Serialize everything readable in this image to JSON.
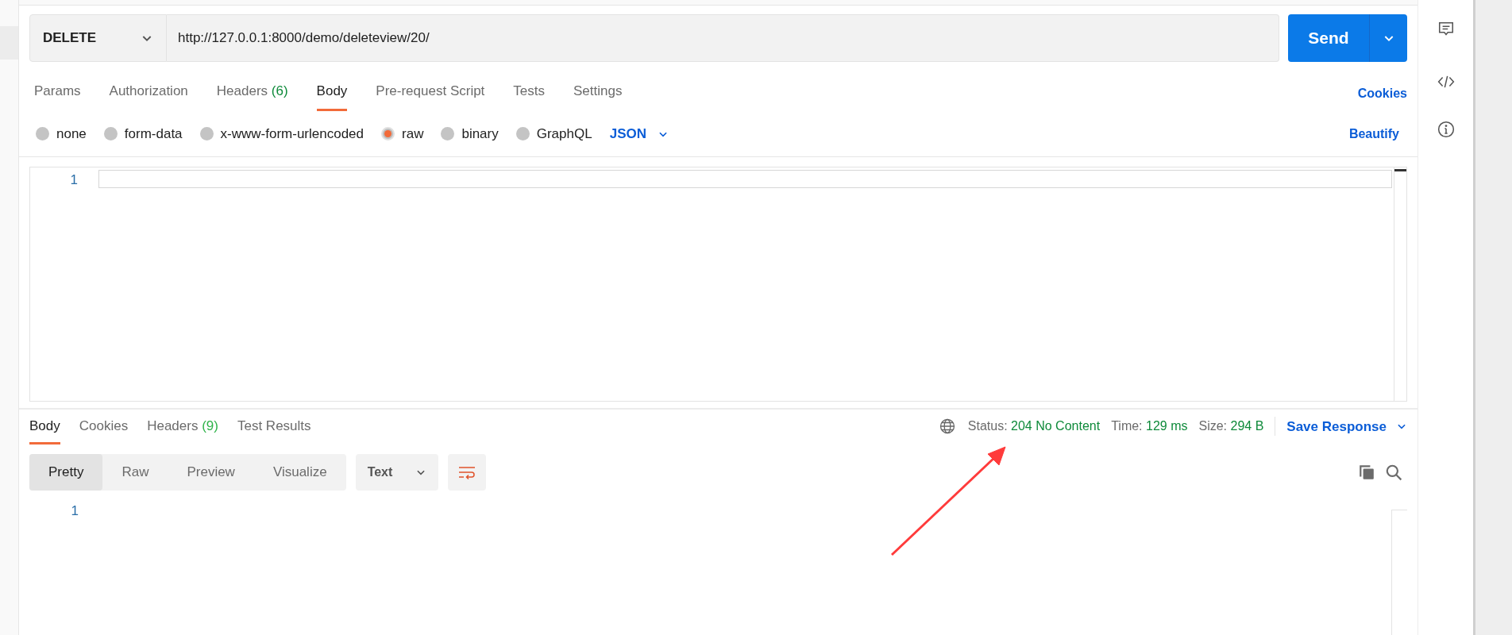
{
  "request": {
    "method": "DELETE",
    "url": "http://127.0.0.1:8000/demo/deleteview/20/",
    "send": "Send"
  },
  "request_tabs": [
    {
      "label": "Params",
      "selected": false
    },
    {
      "label": "Authorization",
      "selected": false
    },
    {
      "label": "Headers",
      "count": "(6)",
      "selected": false
    },
    {
      "label": "Body",
      "selected": true
    },
    {
      "label": "Pre-request Script",
      "selected": false
    },
    {
      "label": "Tests",
      "selected": false
    },
    {
      "label": "Settings",
      "selected": false
    }
  ],
  "cookies_link": "Cookies",
  "body_types": [
    {
      "label": "none",
      "selected": false
    },
    {
      "label": "form-data",
      "selected": false
    },
    {
      "label": "x-www-form-urlencoded",
      "selected": false
    },
    {
      "label": "raw",
      "selected": true
    },
    {
      "label": "binary",
      "selected": false
    },
    {
      "label": "GraphQL",
      "selected": false
    }
  ],
  "body_format": "JSON",
  "beautify": "Beautify",
  "editor_lines": [
    "1"
  ],
  "response_tabs": [
    {
      "label": "Body",
      "selected": true
    },
    {
      "label": "Cookies",
      "selected": false
    },
    {
      "label": "Headers",
      "count": "(9)",
      "selected": false
    },
    {
      "label": "Test Results",
      "selected": false
    }
  ],
  "response_meta": {
    "status_label": "Status:",
    "status": "204 No Content",
    "time_label": "Time:",
    "time": "129 ms",
    "size_label": "Size:",
    "size": "294 B"
  },
  "save_response": "Save Response",
  "view_modes": [
    {
      "label": "Pretty",
      "selected": true
    },
    {
      "label": "Raw",
      "selected": false
    },
    {
      "label": "Preview",
      "selected": false
    },
    {
      "label": "Visualize",
      "selected": false
    }
  ],
  "response_format": "Text",
  "response_lines": [
    "1"
  ]
}
